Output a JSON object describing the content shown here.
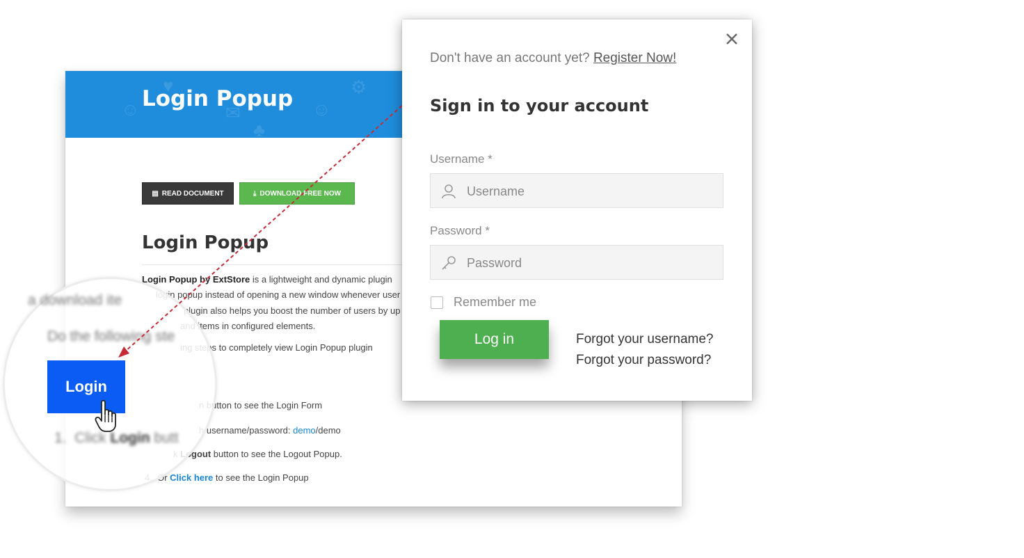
{
  "background_page": {
    "banner_title": "Login Popup",
    "buttons": {
      "read_document": "READ DOCUMENT",
      "download_free": "DOWNLOAD FREE NOW"
    },
    "heading": "Login Popup",
    "paragraph": {
      "line1_bold": "Login Popup by ExtStore",
      "line1_rest": " is a lightweight and dynamic plugin",
      "line2": "login popup instead of opening a new window whenever user",
      "line3": "plugin also helps you boost the number of users by up",
      "line4": "and items in configured elements.",
      "line5": "ing steps to completely view Login Popup plugin"
    },
    "steps": {
      "s1": "n button to see the Login Form",
      "s2_pre": "h username/password: ",
      "s2_link": "demo",
      "s2_post": "/demo",
      "s3_pre": "k ",
      "s3_bold": "Logout",
      "s3_post": " button to see the Logout Popup.",
      "s4_num": "4.",
      "s4_pre": "Or ",
      "s4_link": "Click here",
      "s4_post": " to see the Login Popup"
    }
  },
  "magnifier": {
    "line_a": "a download ite",
    "line_b": "Do the following ste",
    "login_button": "Login",
    "step_num": "1.",
    "step_click": "Click ",
    "step_bold": "Login",
    "step_rest": " butt"
  },
  "modal": {
    "register_prompt": "Don't have an account yet?",
    "register_link": "Register Now!",
    "title": "Sign in to your account",
    "username_label": "Username *",
    "username_placeholder": "Username",
    "password_label": "Password *",
    "password_placeholder": "Password",
    "remember_label": "Remember me",
    "login_button": "Log in",
    "forgot_username": "Forgot your username?",
    "forgot_password": "Forgot your password?"
  },
  "colors": {
    "banner_blue": "#1f8ddc",
    "login_blue": "#0a5cf5",
    "login_green": "#4eaf50",
    "connector_red": "#c62c36"
  },
  "icons": {
    "close": "close-icon",
    "user": "user-icon",
    "key": "key-icon",
    "cursor": "hand-cursor-icon",
    "document": "document-icon",
    "download": "download-icon"
  }
}
